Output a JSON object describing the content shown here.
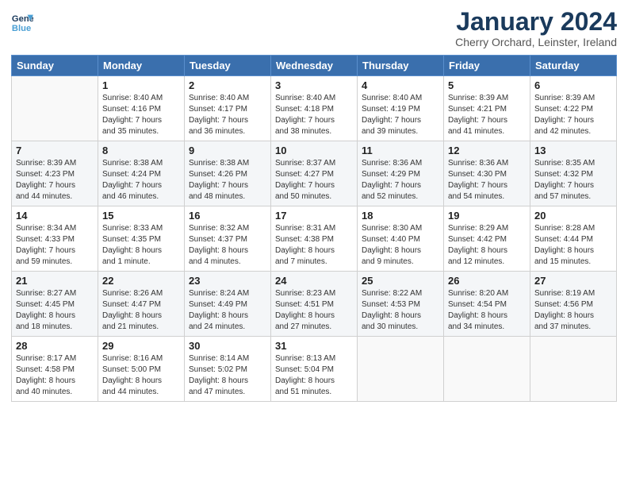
{
  "header": {
    "logo_line1": "General",
    "logo_line2": "Blue",
    "month": "January 2024",
    "location": "Cherry Orchard, Leinster, Ireland"
  },
  "days_of_week": [
    "Sunday",
    "Monday",
    "Tuesday",
    "Wednesday",
    "Thursday",
    "Friday",
    "Saturday"
  ],
  "weeks": [
    [
      {
        "day": "",
        "info": ""
      },
      {
        "day": "1",
        "info": "Sunrise: 8:40 AM\nSunset: 4:16 PM\nDaylight: 7 hours\nand 35 minutes."
      },
      {
        "day": "2",
        "info": "Sunrise: 8:40 AM\nSunset: 4:17 PM\nDaylight: 7 hours\nand 36 minutes."
      },
      {
        "day": "3",
        "info": "Sunrise: 8:40 AM\nSunset: 4:18 PM\nDaylight: 7 hours\nand 38 minutes."
      },
      {
        "day": "4",
        "info": "Sunrise: 8:40 AM\nSunset: 4:19 PM\nDaylight: 7 hours\nand 39 minutes."
      },
      {
        "day": "5",
        "info": "Sunrise: 8:39 AM\nSunset: 4:21 PM\nDaylight: 7 hours\nand 41 minutes."
      },
      {
        "day": "6",
        "info": "Sunrise: 8:39 AM\nSunset: 4:22 PM\nDaylight: 7 hours\nand 42 minutes."
      }
    ],
    [
      {
        "day": "7",
        "info": "Sunrise: 8:39 AM\nSunset: 4:23 PM\nDaylight: 7 hours\nand 44 minutes."
      },
      {
        "day": "8",
        "info": "Sunrise: 8:38 AM\nSunset: 4:24 PM\nDaylight: 7 hours\nand 46 minutes."
      },
      {
        "day": "9",
        "info": "Sunrise: 8:38 AM\nSunset: 4:26 PM\nDaylight: 7 hours\nand 48 minutes."
      },
      {
        "day": "10",
        "info": "Sunrise: 8:37 AM\nSunset: 4:27 PM\nDaylight: 7 hours\nand 50 minutes."
      },
      {
        "day": "11",
        "info": "Sunrise: 8:36 AM\nSunset: 4:29 PM\nDaylight: 7 hours\nand 52 minutes."
      },
      {
        "day": "12",
        "info": "Sunrise: 8:36 AM\nSunset: 4:30 PM\nDaylight: 7 hours\nand 54 minutes."
      },
      {
        "day": "13",
        "info": "Sunrise: 8:35 AM\nSunset: 4:32 PM\nDaylight: 7 hours\nand 57 minutes."
      }
    ],
    [
      {
        "day": "14",
        "info": "Sunrise: 8:34 AM\nSunset: 4:33 PM\nDaylight: 7 hours\nand 59 minutes."
      },
      {
        "day": "15",
        "info": "Sunrise: 8:33 AM\nSunset: 4:35 PM\nDaylight: 8 hours\nand 1 minute."
      },
      {
        "day": "16",
        "info": "Sunrise: 8:32 AM\nSunset: 4:37 PM\nDaylight: 8 hours\nand 4 minutes."
      },
      {
        "day": "17",
        "info": "Sunrise: 8:31 AM\nSunset: 4:38 PM\nDaylight: 8 hours\nand 7 minutes."
      },
      {
        "day": "18",
        "info": "Sunrise: 8:30 AM\nSunset: 4:40 PM\nDaylight: 8 hours\nand 9 minutes."
      },
      {
        "day": "19",
        "info": "Sunrise: 8:29 AM\nSunset: 4:42 PM\nDaylight: 8 hours\nand 12 minutes."
      },
      {
        "day": "20",
        "info": "Sunrise: 8:28 AM\nSunset: 4:44 PM\nDaylight: 8 hours\nand 15 minutes."
      }
    ],
    [
      {
        "day": "21",
        "info": "Sunrise: 8:27 AM\nSunset: 4:45 PM\nDaylight: 8 hours\nand 18 minutes."
      },
      {
        "day": "22",
        "info": "Sunrise: 8:26 AM\nSunset: 4:47 PM\nDaylight: 8 hours\nand 21 minutes."
      },
      {
        "day": "23",
        "info": "Sunrise: 8:24 AM\nSunset: 4:49 PM\nDaylight: 8 hours\nand 24 minutes."
      },
      {
        "day": "24",
        "info": "Sunrise: 8:23 AM\nSunset: 4:51 PM\nDaylight: 8 hours\nand 27 minutes."
      },
      {
        "day": "25",
        "info": "Sunrise: 8:22 AM\nSunset: 4:53 PM\nDaylight: 8 hours\nand 30 minutes."
      },
      {
        "day": "26",
        "info": "Sunrise: 8:20 AM\nSunset: 4:54 PM\nDaylight: 8 hours\nand 34 minutes."
      },
      {
        "day": "27",
        "info": "Sunrise: 8:19 AM\nSunset: 4:56 PM\nDaylight: 8 hours\nand 37 minutes."
      }
    ],
    [
      {
        "day": "28",
        "info": "Sunrise: 8:17 AM\nSunset: 4:58 PM\nDaylight: 8 hours\nand 40 minutes."
      },
      {
        "day": "29",
        "info": "Sunrise: 8:16 AM\nSunset: 5:00 PM\nDaylight: 8 hours\nand 44 minutes."
      },
      {
        "day": "30",
        "info": "Sunrise: 8:14 AM\nSunset: 5:02 PM\nDaylight: 8 hours\nand 47 minutes."
      },
      {
        "day": "31",
        "info": "Sunrise: 8:13 AM\nSunset: 5:04 PM\nDaylight: 8 hours\nand 51 minutes."
      },
      {
        "day": "",
        "info": ""
      },
      {
        "day": "",
        "info": ""
      },
      {
        "day": "",
        "info": ""
      }
    ]
  ]
}
